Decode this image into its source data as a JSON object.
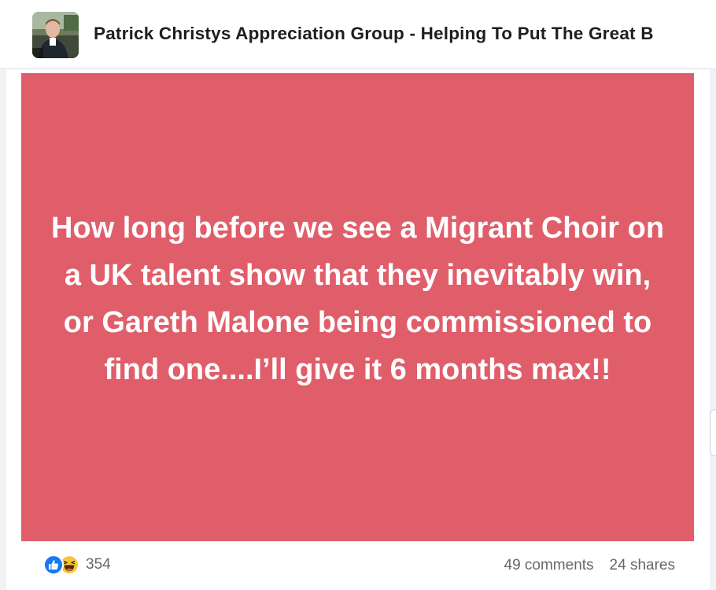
{
  "header": {
    "group_title": "Patrick Christys Appreciation Group - Helping To Put The Great B"
  },
  "post": {
    "text": "How long before we see a Migrant Choir on a UK talent show that they inevitably win, or Gareth Malone being commissioned to find one....I’ll give it 6 months max!!",
    "background_color": "#e05e6a"
  },
  "footer": {
    "reaction_count": "354",
    "comments": "49 comments",
    "shares": "24 shares",
    "reactions": [
      "like-icon",
      "haha-icon"
    ]
  }
}
